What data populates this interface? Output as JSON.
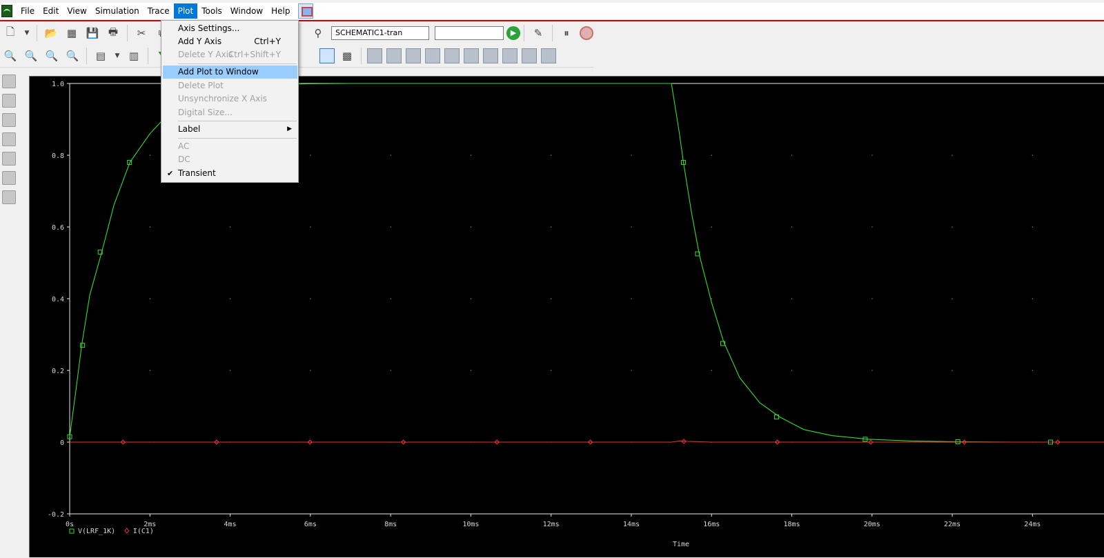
{
  "menubar": {
    "items": [
      "File",
      "Edit",
      "View",
      "Simulation",
      "Trace",
      "Plot",
      "Tools",
      "Window",
      "Help"
    ],
    "active": "Plot"
  },
  "toolbar": {
    "simulation_profile": "SCHEMATIC1-tran"
  },
  "plot_menu": {
    "items": [
      {
        "label": "Axis Settings...",
        "shortcut": "",
        "disabled": false
      },
      {
        "label": "Add Y Axis",
        "shortcut": "Ctrl+Y",
        "disabled": false
      },
      {
        "label": "Delete Y Axis",
        "shortcut": "Ctrl+Shift+Y",
        "disabled": true
      },
      {
        "label": "Add Plot to Window",
        "shortcut": "",
        "disabled": false,
        "highlighted": true
      },
      {
        "label": "Delete Plot",
        "shortcut": "",
        "disabled": true
      },
      {
        "label": "Unsynchronize X Axis",
        "shortcut": "",
        "disabled": true
      },
      {
        "label": "Digital Size...",
        "shortcut": "",
        "disabled": true
      },
      {
        "label": "Label",
        "shortcut": "",
        "disabled": false,
        "submenu": true
      },
      {
        "label": "AC",
        "shortcut": "",
        "disabled": true
      },
      {
        "label": "DC",
        "shortcut": "",
        "disabled": true
      },
      {
        "label": "Transient",
        "shortcut": "",
        "disabled": false,
        "checked": true
      }
    ]
  },
  "chart_data": {
    "type": "line",
    "xlabel": "Time",
    "x_unit": "ms",
    "xlim": [
      0,
      25.8
    ],
    "ylim": [
      -0.2,
      1.0
    ],
    "x_ticks": [
      "0s",
      "2ms",
      "4ms",
      "6ms",
      "8ms",
      "10ms",
      "12ms",
      "14ms",
      "16ms",
      "18ms",
      "20ms",
      "22ms",
      "24ms"
    ],
    "y_ticks": [
      "-0.2",
      "0",
      "0.2",
      "0.4",
      "0.6",
      "0.8",
      "1.0"
    ],
    "y_tick_values": [
      -0.2,
      0,
      0.2,
      0.4,
      0.6,
      0.8,
      1.0
    ],
    "grid": true,
    "legend_position": "bottom-left",
    "series": [
      {
        "name": "V(LRF_1K)",
        "color": "#33dd33",
        "marker": "square",
        "x": [
          0,
          0.15,
          0.3,
          0.5,
          0.8,
          1.1,
          1.5,
          2.0,
          2.5,
          3.0,
          3.5,
          4.0,
          5.0,
          6.0,
          7.0,
          8.0,
          10.0,
          12.0,
          14.0,
          15.0,
          15.1,
          15.2,
          15.3,
          15.5,
          15.7,
          16.0,
          16.3,
          16.7,
          17.2,
          17.7,
          18.3,
          19.0,
          19.9,
          21.0,
          22.2,
          23.5,
          24.5,
          25.8
        ],
        "y": [
          0.015,
          0.14,
          0.27,
          0.41,
          0.53,
          0.66,
          0.78,
          0.86,
          0.92,
          0.955,
          0.975,
          0.99,
          0.997,
          0.999,
          1.0,
          1.0,
          1.0,
          1.0,
          1.0,
          1.0,
          0.93,
          0.86,
          0.78,
          0.64,
          0.52,
          0.39,
          0.28,
          0.18,
          0.11,
          0.07,
          0.035,
          0.018,
          0.008,
          0.003,
          0.001,
          0.0,
          0.0,
          0.0
        ],
        "marker_x": [
          0.0,
          0.32,
          0.76,
          1.49,
          15.3,
          15.65,
          16.28,
          17.62,
          19.83,
          22.14,
          24.45
        ],
        "marker_y": [
          0.015,
          0.27,
          0.53,
          0.78,
          0.78,
          0.525,
          0.275,
          0.07,
          0.008,
          0.001,
          0.0
        ]
      },
      {
        "name": "I(C1)",
        "color": "#ee3333",
        "marker": "diamond",
        "x": [
          0,
          15.0,
          15.2,
          15.4,
          16.0,
          25.8
        ],
        "y": [
          0,
          0,
          0.003,
          0.002,
          0,
          0
        ],
        "marker_x": [
          1.33,
          3.66,
          5.99,
          8.32,
          10.65,
          12.98,
          15.31,
          17.64,
          19.97,
          22.3,
          24.63
        ],
        "marker_y": [
          0,
          0,
          0,
          0,
          0,
          0,
          0.002,
          0,
          0,
          0,
          0
        ]
      }
    ]
  }
}
